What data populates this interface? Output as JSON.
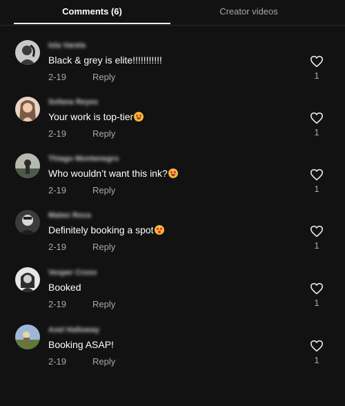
{
  "tabs": [
    {
      "label": "Comments (6)",
      "active": true
    },
    {
      "label": "Creator videos",
      "active": false
    }
  ],
  "comments": [
    {
      "username": "Isla Varela",
      "text": "Black & grey is elite!!!!!!!!!!!",
      "emoji": "",
      "date": "2-19",
      "reply_label": "Reply",
      "likes": "1",
      "avatar_colors": [
        "#c9c9c9",
        "#3a3a3a"
      ]
    },
    {
      "username": "Sofana Reyes",
      "text": "Your work is top-tier",
      "emoji": "smiling-face-with-heart-eyes",
      "date": "2-19",
      "reply_label": "Reply",
      "likes": "1",
      "avatar_colors": [
        "#e8d4c4",
        "#7a5a48"
      ]
    },
    {
      "username": "Thiago Montenegro",
      "text": "Who wouldn’t want this ink?",
      "emoji": "grinning-face",
      "date": "2-19",
      "reply_label": "Reply",
      "likes": "1",
      "avatar_colors": [
        "#b5b9ae",
        "#4c5a48"
      ]
    },
    {
      "username": "Mateo Roca",
      "text": "Definitely booking a spot",
      "emoji": "kissing-face",
      "date": "2-19",
      "reply_label": "Reply",
      "likes": "1",
      "avatar_colors": [
        "#3b3b3b",
        "#d8d8d8"
      ]
    },
    {
      "username": "Vesper Cross",
      "text": "Booked",
      "emoji": "",
      "date": "2-19",
      "reply_label": "Reply",
      "likes": "1",
      "avatar_colors": [
        "#e6e6e6",
        "#2d2d2d"
      ]
    },
    {
      "username": "Axel Halloway",
      "text": "Booking ASAP!",
      "emoji": "",
      "date": "2-19",
      "reply_label": "Reply",
      "likes": "1",
      "avatar_colors": [
        "#9fb7d6",
        "#5e7a3a"
      ]
    }
  ]
}
